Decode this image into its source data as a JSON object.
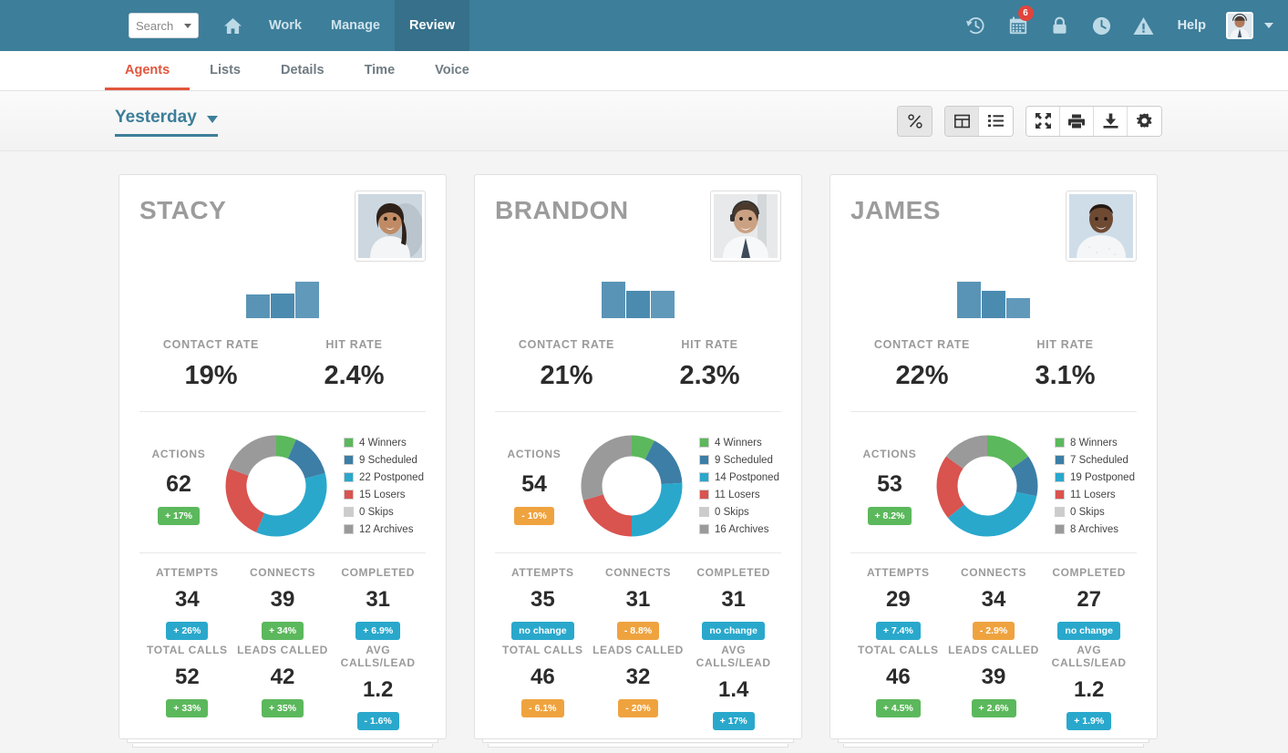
{
  "topnav": {
    "search_placeholder": "Search",
    "links": [
      {
        "label": "Work",
        "active": false
      },
      {
        "label": "Manage",
        "active": false
      },
      {
        "label": "Review",
        "active": true
      }
    ],
    "home_icon": "home-icon",
    "icons": [
      {
        "name": "history-icon"
      },
      {
        "name": "calendar-icon",
        "badge": "6"
      },
      {
        "name": "lock-icon"
      },
      {
        "name": "clock-icon"
      },
      {
        "name": "alert-icon"
      }
    ],
    "help_label": "Help",
    "accent_color": "#3d7e9a"
  },
  "subnav": {
    "tabs": [
      {
        "label": "Agents",
        "active": true
      },
      {
        "label": "Lists",
        "active": false
      },
      {
        "label": "Details",
        "active": false
      },
      {
        "label": "Time",
        "active": false
      },
      {
        "label": "Voice",
        "active": false
      }
    ],
    "active_color": "#e2553d"
  },
  "toolbar": {
    "period_label": "Yesterday",
    "buttons": [
      {
        "name": "percent-toggle-button",
        "active": true
      },
      {
        "name": "grid-view-button",
        "active": true
      },
      {
        "name": "list-view-button",
        "active": false
      },
      {
        "name": "expand-button",
        "active": false
      },
      {
        "name": "print-button",
        "active": false
      },
      {
        "name": "download-button",
        "active": false
      },
      {
        "name": "settings-gear-button",
        "active": false
      }
    ]
  },
  "labels": {
    "contact_rate": "CONTACT RATE",
    "hit_rate": "HIT RATE",
    "actions": "ACTIONS",
    "attempts": "ATTEMPTS",
    "connects": "CONNECTS",
    "completed": "COMPLETED",
    "total_calls": "TOTAL CALLS",
    "leads_called": "LEADS CALLED",
    "avg_calls_lead": "AVG CALLS/LEAD"
  },
  "colors": {
    "winners": "#5cb85c",
    "scheduled": "#3d7ea6",
    "postponed": "#29a8cc",
    "losers": "#d9534f",
    "skips": "#cccccc",
    "archives": "#9a9a9a"
  },
  "cards": [
    {
      "name": "STACY",
      "avatar": "agent-photo-stacy",
      "sparkline": [
        60,
        62,
        100
      ],
      "contact_rate": "19%",
      "hit_rate": "2.4%",
      "actions_value": "62",
      "actions_pill": {
        "text": "+ 17%",
        "color": "green"
      },
      "legend": [
        {
          "label": "4 Winners",
          "value": 4,
          "color": "#5cb85c"
        },
        {
          "label": "9 Scheduled",
          "value": 9,
          "color": "#3d7ea6"
        },
        {
          "label": "22 Postponed",
          "value": 22,
          "color": "#29a8cc"
        },
        {
          "label": "15 Losers",
          "value": 15,
          "color": "#d9534f"
        },
        {
          "label": "0 Skips",
          "value": 0,
          "color": "#cccccc"
        },
        {
          "label": "12 Archives",
          "value": 12,
          "color": "#9a9a9a"
        }
      ],
      "stats": [
        {
          "label": "ATTEMPTS",
          "value": "34",
          "pill": {
            "text": "+ 26%",
            "color": "blue"
          }
        },
        {
          "label": "CONNECTS",
          "value": "39",
          "pill": {
            "text": "+ 34%",
            "color": "green"
          }
        },
        {
          "label": "COMPLETED",
          "value": "31",
          "pill": {
            "text": "+ 6.9%",
            "color": "blue"
          }
        },
        {
          "label": "TOTAL CALLS",
          "value": "52",
          "pill": {
            "text": "+ 33%",
            "color": "green"
          }
        },
        {
          "label": "LEADS CALLED",
          "value": "42",
          "pill": {
            "text": "+ 35%",
            "color": "green"
          }
        },
        {
          "label": "AVG CALLS/LEAD",
          "value": "1.2",
          "pill": {
            "text": "- 1.6%",
            "color": "blue"
          }
        }
      ]
    },
    {
      "name": "BRANDON",
      "avatar": "agent-photo-brandon",
      "sparkline": [
        100,
        72,
        72
      ],
      "contact_rate": "21%",
      "hit_rate": "2.3%",
      "actions_value": "54",
      "actions_pill": {
        "text": "- 10%",
        "color": "orange"
      },
      "legend": [
        {
          "label": "4 Winners",
          "value": 4,
          "color": "#5cb85c"
        },
        {
          "label": "9 Scheduled",
          "value": 9,
          "color": "#3d7ea6"
        },
        {
          "label": "14 Postponed",
          "value": 14,
          "color": "#29a8cc"
        },
        {
          "label": "11 Losers",
          "value": 11,
          "color": "#d9534f"
        },
        {
          "label": "0 Skips",
          "value": 0,
          "color": "#cccccc"
        },
        {
          "label": "16 Archives",
          "value": 16,
          "color": "#9a9a9a"
        }
      ],
      "stats": [
        {
          "label": "ATTEMPTS",
          "value": "35",
          "pill": {
            "text": "no change",
            "color": "blue"
          }
        },
        {
          "label": "CONNECTS",
          "value": "31",
          "pill": {
            "text": "- 8.8%",
            "color": "orange"
          }
        },
        {
          "label": "COMPLETED",
          "value": "31",
          "pill": {
            "text": "no change",
            "color": "blue"
          }
        },
        {
          "label": "TOTAL CALLS",
          "value": "46",
          "pill": {
            "text": "- 6.1%",
            "color": "orange"
          }
        },
        {
          "label": "LEADS CALLED",
          "value": "32",
          "pill": {
            "text": "- 20%",
            "color": "orange"
          }
        },
        {
          "label": "AVG CALLS/LEAD",
          "value": "1.4",
          "pill": {
            "text": "+ 17%",
            "color": "blue"
          }
        }
      ]
    },
    {
      "name": "JAMES",
      "avatar": "agent-photo-james",
      "sparkline": [
        100,
        70,
        46
      ],
      "contact_rate": "22%",
      "hit_rate": "3.1%",
      "actions_value": "53",
      "actions_pill": {
        "text": "+ 8.2%",
        "color": "green"
      },
      "legend": [
        {
          "label": "8 Winners",
          "value": 8,
          "color": "#5cb85c"
        },
        {
          "label": "7 Scheduled",
          "value": 7,
          "color": "#3d7ea6"
        },
        {
          "label": "19 Postponed",
          "value": 19,
          "color": "#29a8cc"
        },
        {
          "label": "11 Losers",
          "value": 11,
          "color": "#d9534f"
        },
        {
          "label": "0 Skips",
          "value": 0,
          "color": "#cccccc"
        },
        {
          "label": "8 Archives",
          "value": 8,
          "color": "#9a9a9a"
        }
      ],
      "stats": [
        {
          "label": "ATTEMPTS",
          "value": "29",
          "pill": {
            "text": "+ 7.4%",
            "color": "blue"
          }
        },
        {
          "label": "CONNECTS",
          "value": "34",
          "pill": {
            "text": "- 2.9%",
            "color": "orange"
          }
        },
        {
          "label": "COMPLETED",
          "value": "27",
          "pill": {
            "text": "no change",
            "color": "blue"
          }
        },
        {
          "label": "TOTAL CALLS",
          "value": "46",
          "pill": {
            "text": "+ 4.5%",
            "color": "green"
          }
        },
        {
          "label": "LEADS CALLED",
          "value": "39",
          "pill": {
            "text": "+ 2.6%",
            "color": "green"
          }
        },
        {
          "label": "AVG CALLS/LEAD",
          "value": "1.2",
          "pill": {
            "text": "+ 1.9%",
            "color": "blue"
          }
        }
      ]
    }
  ]
}
